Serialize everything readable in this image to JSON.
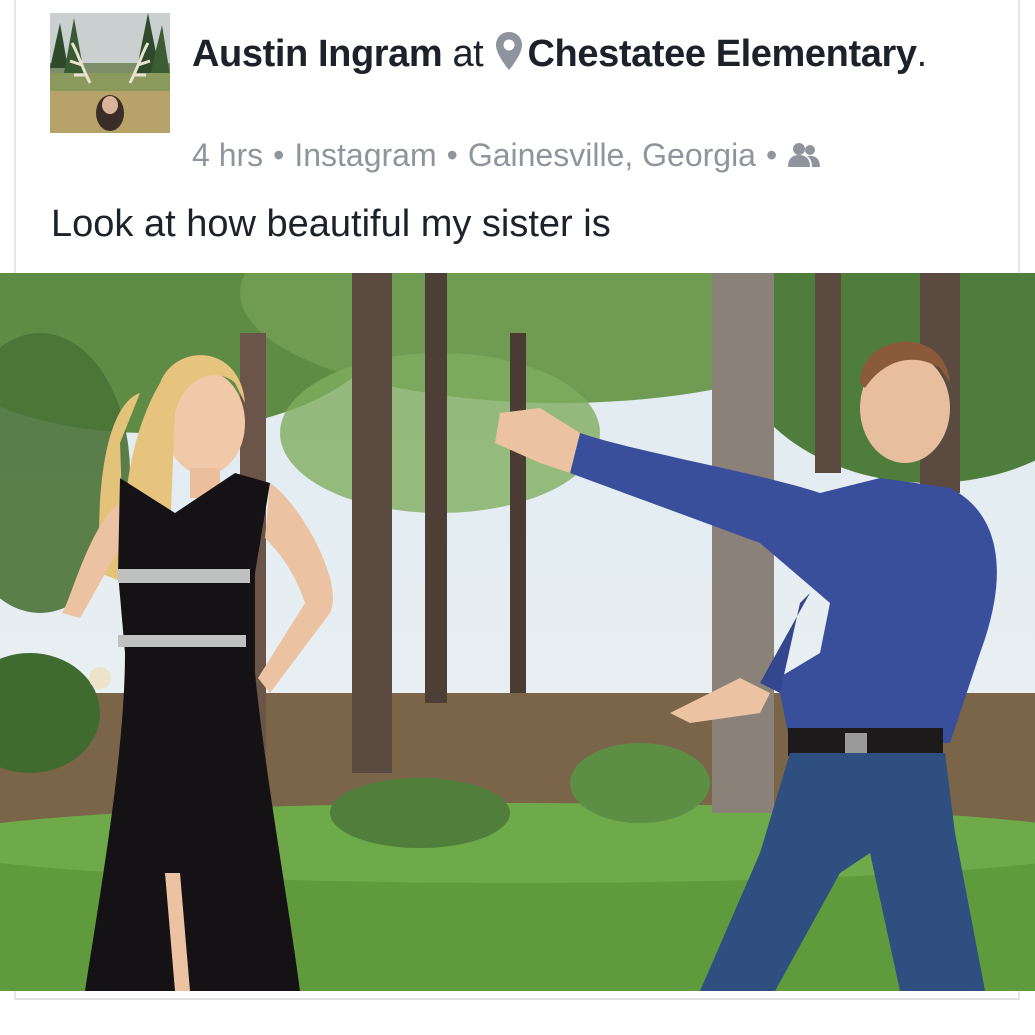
{
  "post": {
    "author": "Austin Ingram",
    "at_word": "at",
    "location_icon": "map-pin-icon",
    "place": "Chestatee Elementary",
    "period": ".",
    "time": "4 hrs",
    "separator": "•",
    "source": "Instagram",
    "location": "Gainesville, Georgia",
    "audience_icon": "friends-icon",
    "text": "Look at how beautiful my sister is"
  },
  "colors": {
    "name_text": "#1d2129",
    "meta_text": "#90949c",
    "divider": "#e4e6eb"
  }
}
